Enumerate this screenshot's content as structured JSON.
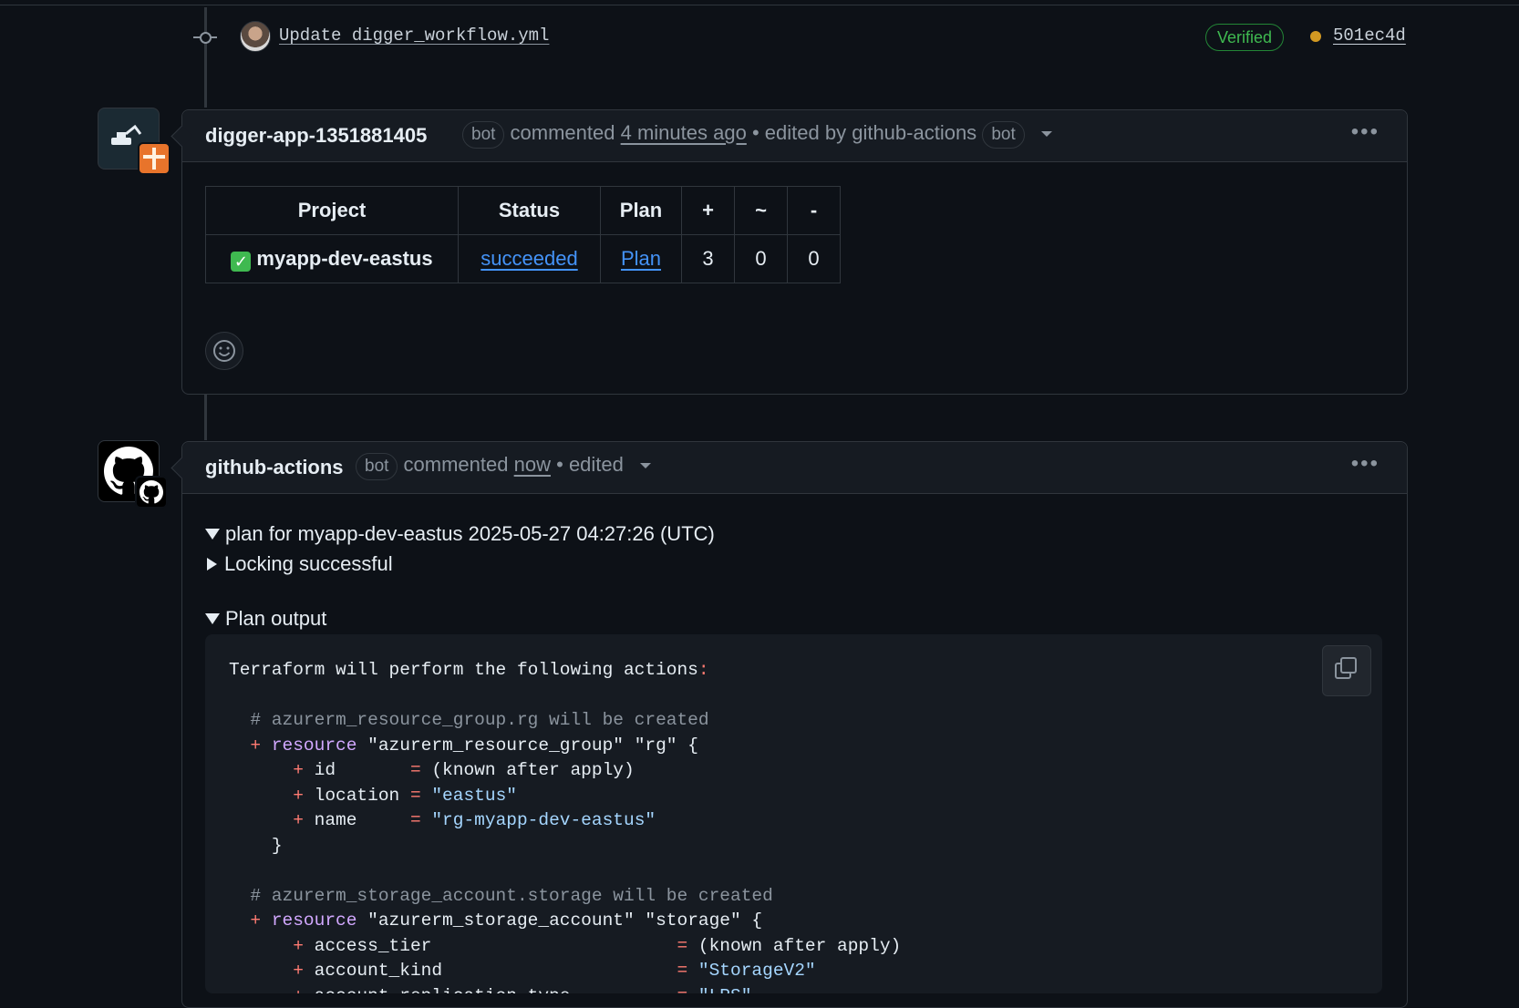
{
  "commit": {
    "message": "Update digger_workflow.yml",
    "verified_label": "Verified",
    "sha": "501ec4d",
    "status_color": "#d29922"
  },
  "comment1": {
    "author": "digger-app-1351881405",
    "bot_label": "bot",
    "action": "commented",
    "time": "4 minutes ago",
    "separator": "•",
    "edited_prefix": "edited by",
    "editor": "github-actions",
    "editor_bot_label": "bot",
    "table": {
      "headers": [
        "Project",
        "Status",
        "Plan",
        "+",
        "~",
        "-"
      ],
      "row": {
        "project": "myapp-dev-eastus",
        "status": "succeeded",
        "plan": "Plan",
        "add": "3",
        "change": "0",
        "destroy": "0"
      }
    }
  },
  "comment2": {
    "author": "github-actions",
    "bot_label": "bot",
    "action": "commented",
    "time": "now",
    "separator": "•",
    "edited": "edited",
    "summary_plan": "plan for myapp-dev-eastus 2025-05-27 04:27:26 (UTC)",
    "summary_lock": "Locking successful",
    "summary_output": "Plan output",
    "code_lines": {
      "l1": "Terraform will perform the following actions",
      "l1_colon": ":",
      "c1": "# azurerm_resource_group.rg will be created",
      "r1_kw": "resource",
      "r1_rest": "\"azurerm_resource_group\" \"rg\" {",
      "id_key": "id      ",
      "id_val": "(known after apply)",
      "loc_key": "location",
      "loc_val": "\"eastus\"",
      "name_key": "name    ",
      "name_val": "\"rg-myapp-dev-eastus\"",
      "close": "}",
      "c2": "# azurerm_storage_account.storage will be created",
      "r2_kw": "resource",
      "r2_rest": "\"azurerm_storage_account\" \"storage\" {",
      "at_key": "access_tier                      ",
      "at_val": "(known after apply)",
      "ak_key": "account_kind                     ",
      "ak_val": "\"StorageV2\"",
      "art_key": "account_replication_type         ",
      "art_val": "\"LRS\"",
      "plus": "+",
      "eq": "="
    }
  },
  "accent_colors": {
    "link": "#4493f8",
    "verified": "#3fb950",
    "diff_plus": "#ff7b72"
  }
}
